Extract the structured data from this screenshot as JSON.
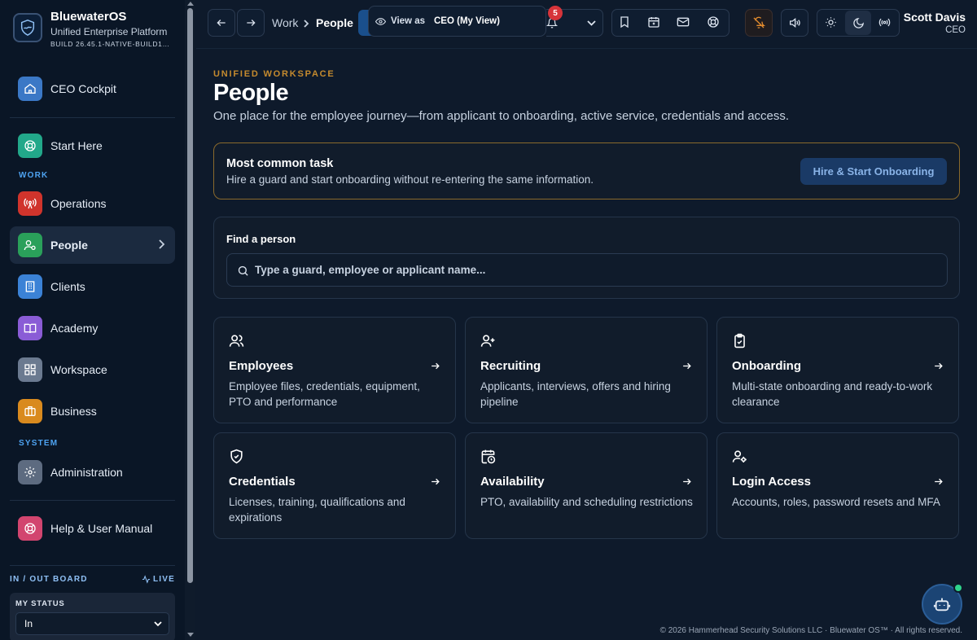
{
  "brand": {
    "name": "BluewaterOS",
    "subtitle": "Unified Enterprise Platform",
    "build": "BUILD 26.45.1-NATIVE-BUILD1…"
  },
  "sidebar": {
    "cockpit": "CEO Cockpit",
    "start_here": "Start Here",
    "section_work": "WORK",
    "section_system": "SYSTEM",
    "items": [
      {
        "label": "Operations",
        "color": "#d0342c"
      },
      {
        "label": "People",
        "color": "#2aa05a"
      },
      {
        "label": "Clients",
        "color": "#3b82d6"
      },
      {
        "label": "Academy",
        "color": "#8a5cd6"
      },
      {
        "label": "Workspace",
        "color": "#6b7a90"
      },
      {
        "label": "Business",
        "color": "#d98a1e"
      }
    ],
    "administration": "Administration",
    "help": "Help & User Manual",
    "io_board": {
      "title": "IN / OUT BOARD",
      "live": "LIVE",
      "my_status_label": "MY STATUS",
      "my_status_value": "In"
    }
  },
  "topbar": {
    "breadcrumb": [
      "Work",
      "People"
    ],
    "view_as_label": "View as",
    "view_as_value": "CEO (My View)",
    "notification_count": "5",
    "user_name": "Scott Davis",
    "user_role": "CEO"
  },
  "main": {
    "eyebrow": "UNIFIED WORKSPACE",
    "title": "People",
    "lead": "One place for the employee journey—from applicant to onboarding, active service, credentials and access.",
    "task": {
      "title": "Most common task",
      "desc": "Hire a guard and start onboarding without re-entering the same information.",
      "button": "Hire & Start Onboarding"
    },
    "find": {
      "title": "Find a person",
      "placeholder": "Type a guard, employee or applicant name..."
    },
    "cards": [
      {
        "title": "Employees",
        "desc": "Employee files, credentials, equipment, PTO and performance",
        "icon": "users-icon"
      },
      {
        "title": "Recruiting",
        "desc": "Applicants, interviews, offers and hiring pipeline",
        "icon": "user-plus-icon"
      },
      {
        "title": "Onboarding",
        "desc": "Multi-state onboarding and ready-to-work clearance",
        "icon": "clipboard-check-icon"
      },
      {
        "title": "Credentials",
        "desc": "Licenses, training, qualifications and expirations",
        "icon": "shield-check-icon"
      },
      {
        "title": "Availability",
        "desc": "PTO, availability and scheduling restrictions",
        "icon": "calendar-clock-icon"
      },
      {
        "title": "Login Access",
        "desc": "Accounts, roles, password resets and MFA",
        "icon": "user-cog-icon"
      }
    ]
  },
  "footer": "© 2026 Hammerhead Security Solutions LLC · Bluewater OS™ · All rights reserved.",
  "colors": {
    "accent_gold": "#c48a2e",
    "accent_blue": "#4ea3f1",
    "background": "#0e1a2b"
  }
}
